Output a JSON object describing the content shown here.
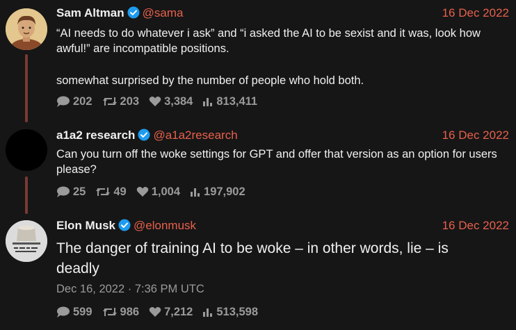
{
  "tweets": [
    {
      "name": "Sam Altman",
      "handle": "@sama",
      "date": "16 Dec 2022",
      "text1": "“AI needs to do whatever i ask” and “i asked the AI to be sexist and it was, look how awful!” are incompatible positions.",
      "text2": "somewhat surprised by the number of people who hold both.",
      "replies": "202",
      "retweets": "203",
      "likes": "3,384",
      "views": "813,411"
    },
    {
      "name": "a1a2 research",
      "handle": "@a1a2research",
      "date": "16 Dec 2022",
      "text1": "Can you turn off the woke settings for GPT and offer that version as an option for users please?",
      "replies": "25",
      "retweets": "49",
      "likes": "1,004",
      "views": "197,902"
    },
    {
      "name": "Elon Musk",
      "handle": "@elonmusk",
      "date": "16 Dec 2022",
      "text1": "The danger of training AI to be woke – in other words, lie – is deadly",
      "timestamp": "Dec 16, 2022 · 7:36 PM UTC",
      "replies": "599",
      "retweets": "986",
      "likes": "7,212",
      "views": "513,598"
    }
  ],
  "colors": {
    "background": "#161616",
    "accent": "#e8604c",
    "verified": "#1d9bf0",
    "thread_line": "#7a3a34",
    "muted": "#9a9a9a"
  },
  "icons": [
    "verified-badge-icon",
    "reply-icon",
    "retweet-icon",
    "like-icon",
    "views-icon"
  ]
}
